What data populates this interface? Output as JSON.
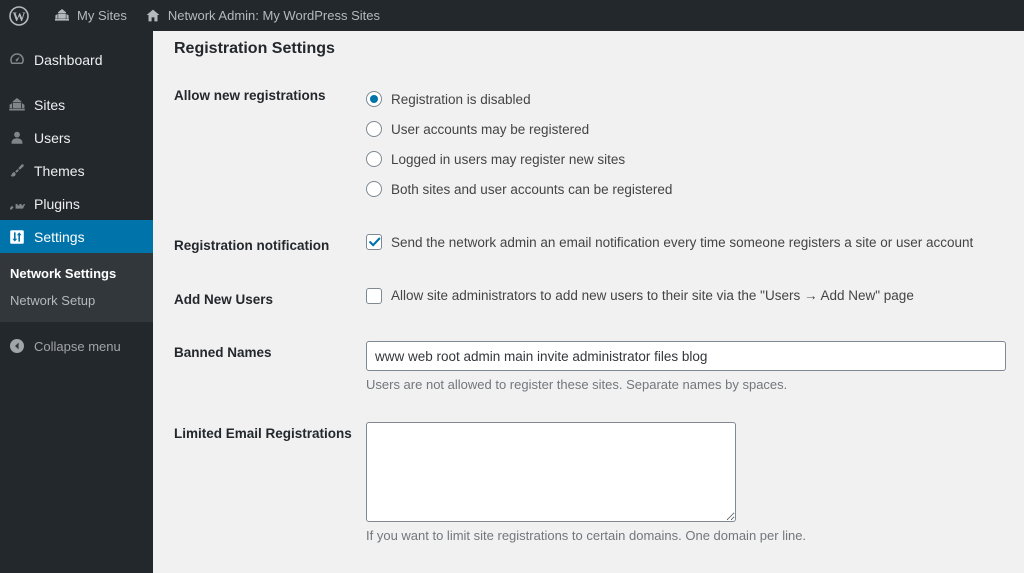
{
  "adminbar": {
    "logo_icon": "wordpress-logo-icon",
    "items": [
      {
        "label": "My Sites",
        "icon": "buildings-icon"
      },
      {
        "label": "Network Admin: My WordPress Sites",
        "icon": "home-icon"
      }
    ]
  },
  "sidebar": {
    "items": [
      {
        "label": "Dashboard",
        "icon": "dashboard-icon",
        "current": false
      },
      {
        "label": "Sites",
        "icon": "buildings-icon",
        "current": false
      },
      {
        "label": "Users",
        "icon": "user-icon",
        "current": false
      },
      {
        "label": "Themes",
        "icon": "paintbrush-icon",
        "current": false
      },
      {
        "label": "Plugins",
        "icon": "plug-icon",
        "current": false
      },
      {
        "label": "Settings",
        "icon": "settings-sliders-icon",
        "current": true
      }
    ],
    "submenu": [
      {
        "label": "Network Settings",
        "current": true
      },
      {
        "label": "Network Setup",
        "current": false
      }
    ],
    "collapse": {
      "label": "Collapse menu",
      "icon": "arrow-left-circle-icon"
    }
  },
  "page": {
    "title": "Registration Settings"
  },
  "form": {
    "allow_registrations": {
      "label": "Allow new registrations",
      "options": [
        {
          "label": "Registration is disabled",
          "selected": true
        },
        {
          "label": "User accounts may be registered",
          "selected": false
        },
        {
          "label": "Logged in users may register new sites",
          "selected": false
        },
        {
          "label": "Both sites and user accounts can be registered",
          "selected": false
        }
      ]
    },
    "registration_notification": {
      "label": "Registration notification",
      "checkbox_label": "Send the network admin an email notification every time someone registers a site or user account",
      "checked": true
    },
    "add_new_users": {
      "label": "Add New Users",
      "checkbox_label": "Allow site administrators to add new users to their site via the \"Users → Add New\" page",
      "checked": false
    },
    "banned_names": {
      "label": "Banned Names",
      "value": "www web root admin main invite administrator files blog",
      "placeholder": "",
      "description": "Users are not allowed to register these sites. Separate names by spaces."
    },
    "limited_email_registrations": {
      "label": "Limited Email Registrations",
      "value": "",
      "placeholder": "",
      "description": "If you want to limit site registrations to certain domains. One domain per line."
    }
  },
  "colors": {
    "adminbar_bg": "#23282d",
    "sidebar_bg": "#23282d",
    "submenu_bg": "#32373c",
    "accent": "#0073aa",
    "content_bg": "#f1f1f1"
  }
}
